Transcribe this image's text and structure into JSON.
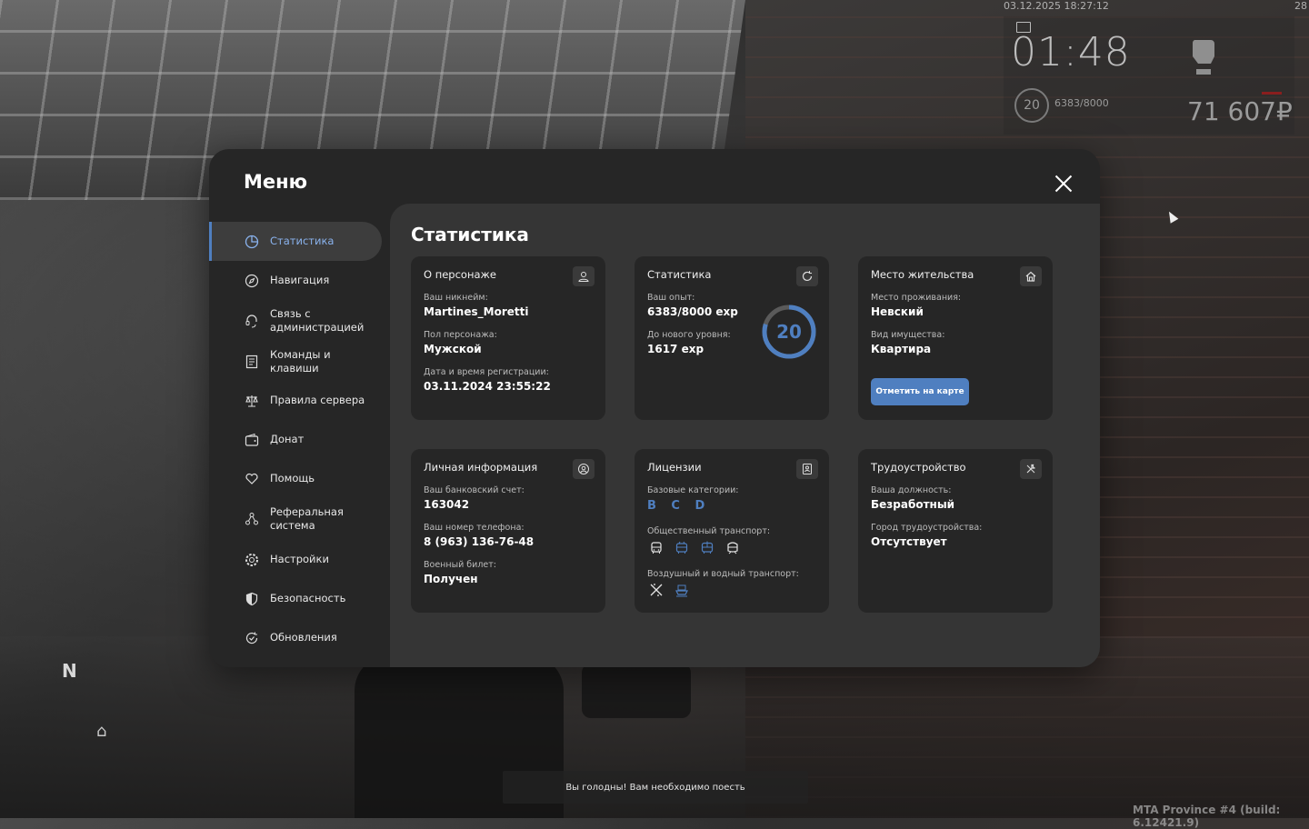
{
  "hud": {
    "datetime": "03.12.2025 18:27:12",
    "corner_number": "28",
    "time": "01:48",
    "level": "20",
    "exp": "6383/8000",
    "money": "71 607₽",
    "icons": [
      "mail-icon",
      "fist-icon"
    ]
  },
  "menu": {
    "title": "Меню",
    "sidebar": [
      {
        "label": "Статистика",
        "icon": "pie-chart-icon",
        "active": true
      },
      {
        "label": "Навигация",
        "icon": "compass-icon"
      },
      {
        "label": "Связь с администрацией",
        "icon": "headset-icon"
      },
      {
        "label": "Команды и клавиши",
        "icon": "list-icon"
      },
      {
        "label": "Правила сервера",
        "icon": "scales-icon"
      },
      {
        "label": "Донат",
        "icon": "wallet-icon"
      },
      {
        "label": "Помощь",
        "icon": "heart-hand-icon"
      },
      {
        "label": "Реферальная система",
        "icon": "network-icon"
      },
      {
        "label": "Настройки",
        "icon": "gear-icon"
      },
      {
        "label": "Безопасность",
        "icon": "shield-icon"
      },
      {
        "label": "Обновления",
        "icon": "refresh-check-icon"
      }
    ]
  },
  "content": {
    "title": "Статистика",
    "character": {
      "title": "О персонаже",
      "nick_label": "Ваш никнейм:",
      "nick": "Martines_Moretti",
      "gender_label": "Пол персонажа:",
      "gender": "Мужской",
      "reg_label": "Дата и время регистрации:",
      "reg": "03.11.2024 23:55:22"
    },
    "stats": {
      "title": "Статистика",
      "exp_label": "Ваш опыт:",
      "exp": "6383/8000 exp",
      "next_label": "До нового уровня:",
      "next": "1617 exp",
      "level": "20",
      "progress": 0.798
    },
    "residence": {
      "title": "Место жительства",
      "place_label": "Место проживания:",
      "place": "Невский",
      "property_label": "Вид имущества:",
      "property": "Квартира",
      "map_button": "Отметить на карте"
    },
    "personal": {
      "title": "Личная информация",
      "bank_label": "Ваш банковский счет:",
      "bank": "163042",
      "phone_label": "Ваш номер телефона:",
      "phone": "8 (963) 136-76-48",
      "military_label": "Военный билет:",
      "military": "Получен"
    },
    "licenses": {
      "title": "Лицензии",
      "base_label": "Базовые категории:",
      "base": "B C D",
      "public_label": "Общественный транспорт:",
      "air_label": "Воздушный и водный транспорт:"
    },
    "employment": {
      "title": "Трудоустройство",
      "position_label": "Ваша должность:",
      "position": "Безработный",
      "city_label": "Город трудоустройства:",
      "city": "Отсутствует"
    }
  },
  "notification": "Вы голодны! Вам необходимо поесть",
  "compass": "N",
  "build": "MTA Province #4 (build: 6.12421.9)",
  "colors": {
    "accent": "#4f7fc0",
    "window": "#262626",
    "content": "#353535"
  }
}
